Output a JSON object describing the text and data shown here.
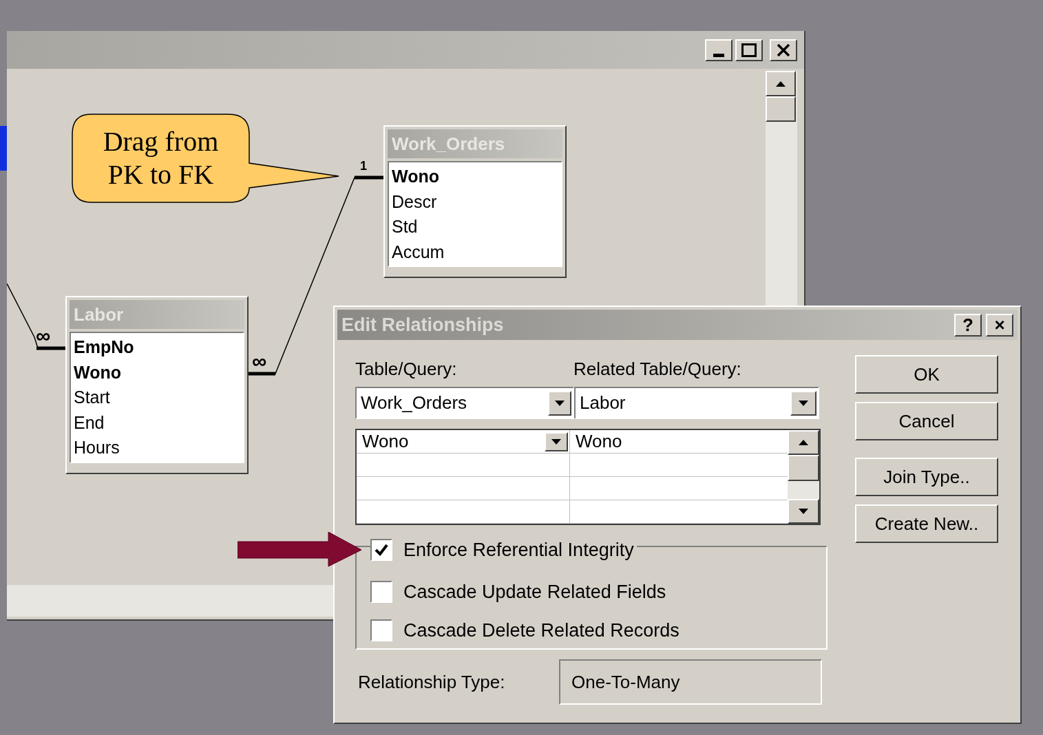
{
  "callout": {
    "lines": [
      "Drag from",
      "PK to FK"
    ]
  },
  "join_marks": {
    "one": "1",
    "many": [
      "∞",
      "∞"
    ]
  },
  "tables": [
    {
      "title": "Work_Orders",
      "fields": [
        {
          "name": "Wono",
          "primary_key": true
        },
        {
          "name": "Descr",
          "primary_key": false
        },
        {
          "name": "Std",
          "primary_key": false
        },
        {
          "name": "Accum",
          "primary_key": false
        }
      ]
    },
    {
      "title": "Labor",
      "fields": [
        {
          "name": "EmpNo",
          "primary_key": true
        },
        {
          "name": "Wono",
          "primary_key": true
        },
        {
          "name": "Start",
          "primary_key": false
        },
        {
          "name": "End",
          "primary_key": false
        },
        {
          "name": "Hours",
          "primary_key": false
        }
      ]
    }
  ],
  "dialog": {
    "title": "Edit Relationships",
    "title_buttons": [
      "?",
      "×"
    ],
    "table_label": "Table/Query:",
    "related_label": "Related Table/Query:",
    "table": "Work_Orders",
    "related_table": "Labor",
    "field_rows": [
      {
        "field": "Wono",
        "related_field": "Wono"
      }
    ],
    "options": [
      {
        "label": "Enforce Referential Integrity",
        "checked": true
      },
      {
        "label": "Cascade Update Related Fields",
        "checked": false
      },
      {
        "label": "Cascade Delete Related Records",
        "checked": false
      }
    ],
    "relationship_type_label": "Relationship Type:",
    "relationship_type": "One-To-Many",
    "buttons": [
      "OK",
      "Cancel",
      "Join Type..",
      "Create New.."
    ]
  }
}
